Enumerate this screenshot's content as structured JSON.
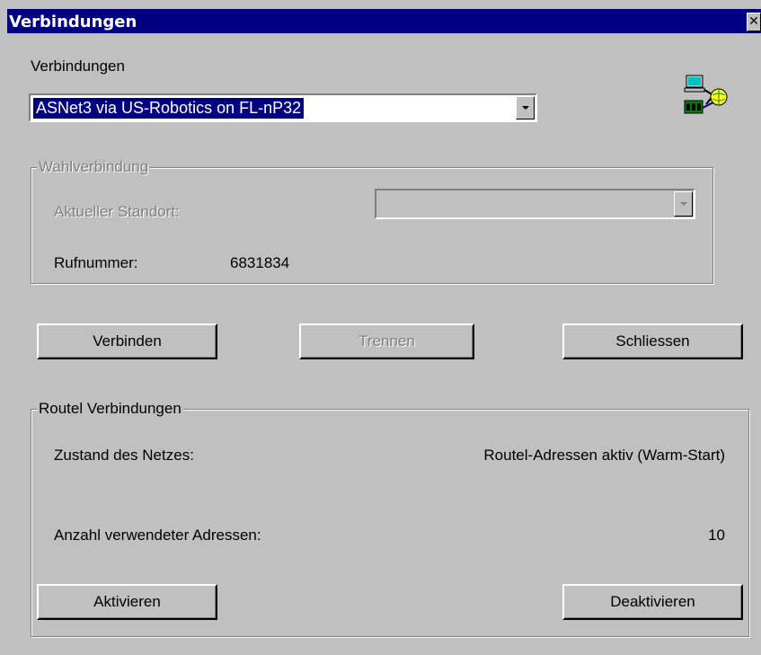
{
  "window": {
    "title": "Verbindungen",
    "close_glyph": "✕"
  },
  "connections": {
    "label": "Verbindungen",
    "selected_value": "ASNet3 via US-Robotics on FL-nP32",
    "icon": "network-computers-icon"
  },
  "dial_group": {
    "legend": "Wahlverbindung",
    "location_label": "Aktueller Standort:",
    "location_value": "",
    "phone_label": "Rufnummer:",
    "phone_value": "6831834"
  },
  "buttons": {
    "connect": "Verbinden",
    "disconnect": "Trennen",
    "close": "Schliessen"
  },
  "routel_group": {
    "legend": "Routel Verbindungen",
    "network_state_label": "Zustand des Netzes:",
    "network_state_value": "Routel-Adressen aktiv (Warm-Start)",
    "address_count_label": "Anzahl verwendeter Adressen:",
    "address_count_value": "10",
    "activate": "Aktivieren",
    "deactivate": "Deaktivieren"
  },
  "colors": {
    "titlebar": "#000080",
    "face": "#c0c0c0",
    "selection": "#000080"
  }
}
